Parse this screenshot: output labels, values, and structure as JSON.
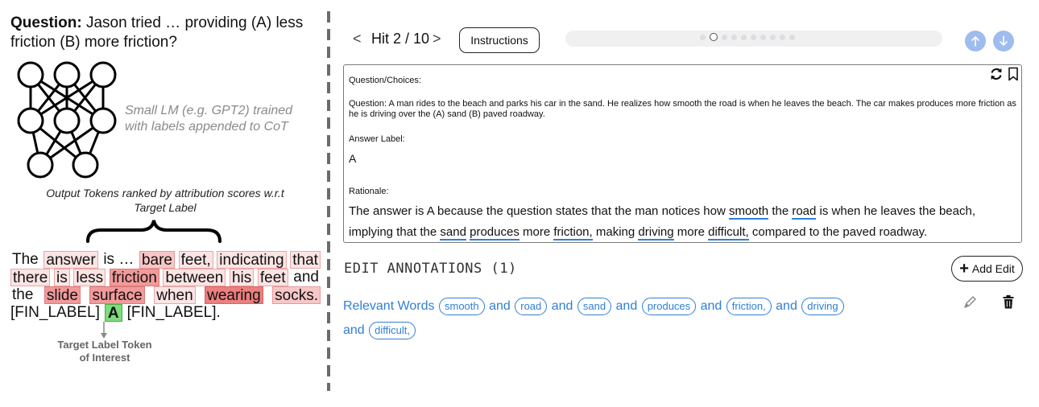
{
  "left": {
    "question_label": "Question:",
    "question_text": " Jason tried … providing (A) less friction (B) more friction?",
    "model_caption": "Small LM (e.g. GPT2) trained with labels appended to CoT",
    "output_caption": "Output Tokens ranked by attribution scores w.r.t Target Label",
    "target_caption": "Target Label Token of Interest",
    "cot": {
      "l1": [
        "The",
        "answer",
        "is …",
        "bare",
        "feet,",
        "indicating",
        "that"
      ],
      "l2": [
        "there",
        "is",
        "less",
        "friction",
        "between",
        "his",
        "feet",
        "and"
      ],
      "l3": [
        "the",
        "slide",
        "surface",
        "when",
        "wearing",
        "socks."
      ],
      "l4": [
        "[FIN_LABEL]",
        "A",
        "[FIN_LABEL]."
      ]
    }
  },
  "toolbar": {
    "prev": "<",
    "hit_label": "Hit 2 / 10",
    "next": ">",
    "instructions": "Instructions"
  },
  "annotation": {
    "qc_label": "Question/Choices:",
    "question": "Question: A man rides to the beach and parks his car in the sand. He realizes how smooth the road is when he leaves the beach. The car makes produces more friction as he is driving over the (A) sand (B) paved roadway.",
    "answer_label": "Answer Label:",
    "answer": "A",
    "rationale_label": "Rationale:",
    "rationale": {
      "p1": "The answer is A because the question states that the man notices how ",
      "w1": "smooth",
      "p2": " the ",
      "w2": "road",
      "p3": " is when he leaves the beach, implying that the ",
      "w3": "sand",
      "p4": " ",
      "w4": "produces",
      "p5": " more ",
      "w5": "friction,",
      "p6": " making ",
      "w6": "driving",
      "p7": " more ",
      "w7": "difficult,",
      "p8": " compared to the paved roadway."
    }
  },
  "edits": {
    "title": "EDIT ANNOTATIONS (1)",
    "add_label": "Add Edit",
    "relevant_label": "Relevant Words",
    "joiner": "and",
    "words": [
      "smooth",
      "road",
      "sand",
      "produces",
      "friction,",
      "driving",
      "difficult,"
    ]
  },
  "progress": {
    "current": 2,
    "total": 10
  },
  "colors": {
    "accent_blue": "#2f7fd6",
    "nav_button": "#9fbcef",
    "attribution_low": "#fbe4e4",
    "attribution_high": "#ec7f7f",
    "target_green": "#7ddc7d"
  },
  "icons": [
    "refresh-icon",
    "bookmark-icon",
    "up-arrow-icon",
    "down-arrow-icon",
    "plus-icon",
    "pencil-icon",
    "trash-icon"
  ]
}
